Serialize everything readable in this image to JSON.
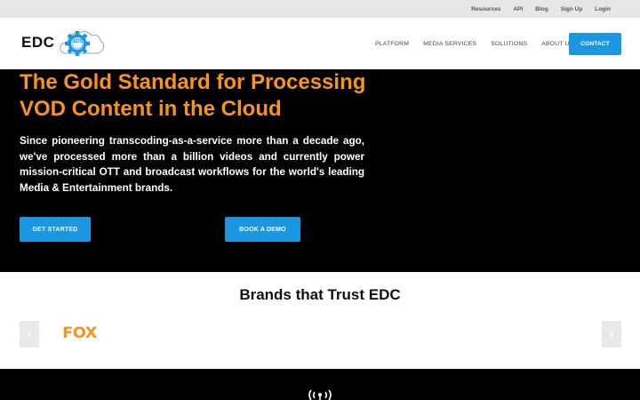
{
  "topbar": {
    "links": [
      "Resources",
      "API",
      "Blog",
      "Sign Up",
      "Login"
    ]
  },
  "header": {
    "logo_text": "EDC",
    "logo_badge": "EDC",
    "nav": [
      "PLATFORM",
      "MEDIA SERVICES",
      "SOLUTIONS",
      "ABOUT US"
    ],
    "contact_label": "CONTACT"
  },
  "hero": {
    "title": "The Gold Standard for Processing VOD Content in the Cloud",
    "text": "Since pioneering transcoding-as-a-service more than a decade ago, we've processed more than a billion videos and currently power mission-critical OTT and broadcast workflows for the world's leading Media & Entertainment brands.",
    "get_started_label": "GET STARTED",
    "book_demo_label": "BOOK A DEMO"
  },
  "brands": {
    "title": "Brands that Trust EDC",
    "logos": [
      "FOX"
    ],
    "prev_icon": "‹",
    "next_icon": "›"
  },
  "colors": {
    "accent_blue": "#1a97e0",
    "accent_orange": "#f7941d"
  },
  "icons": {
    "logo": "gear-cloud-icon",
    "footer": "broadcast-icon"
  }
}
